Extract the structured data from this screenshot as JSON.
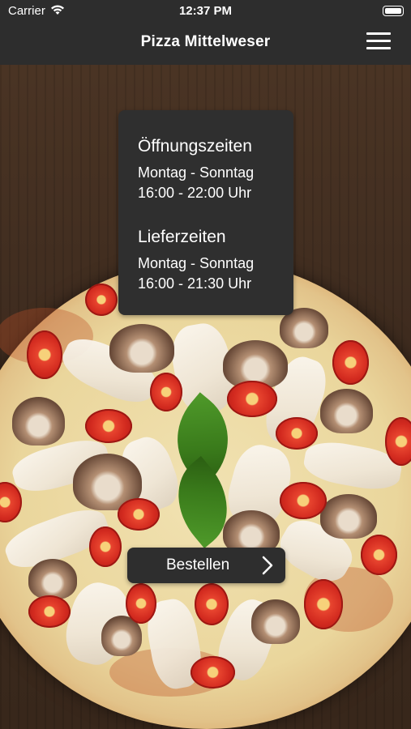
{
  "status_bar": {
    "carrier": "Carrier",
    "time": "12:37 PM"
  },
  "nav": {
    "title": "Pizza Mittelweser",
    "menu_icon": "hamburger-menu-icon"
  },
  "hours_card": {
    "opening_heading": "Öffnungszeiten",
    "opening_days": "Montag - Sonntag",
    "opening_time": "16:00 - 22:00 Uhr",
    "delivery_heading": "Lieferzeiten",
    "delivery_days": "Montag - Sonntag",
    "delivery_time": "16:00 - 21:30 Uhr"
  },
  "order_button": {
    "label": "Bestellen",
    "icon": "chevron-right-icon"
  },
  "colors": {
    "bar_background": "#2d2d2d",
    "card_background": "#2f2f2f",
    "text": "#ffffff"
  }
}
